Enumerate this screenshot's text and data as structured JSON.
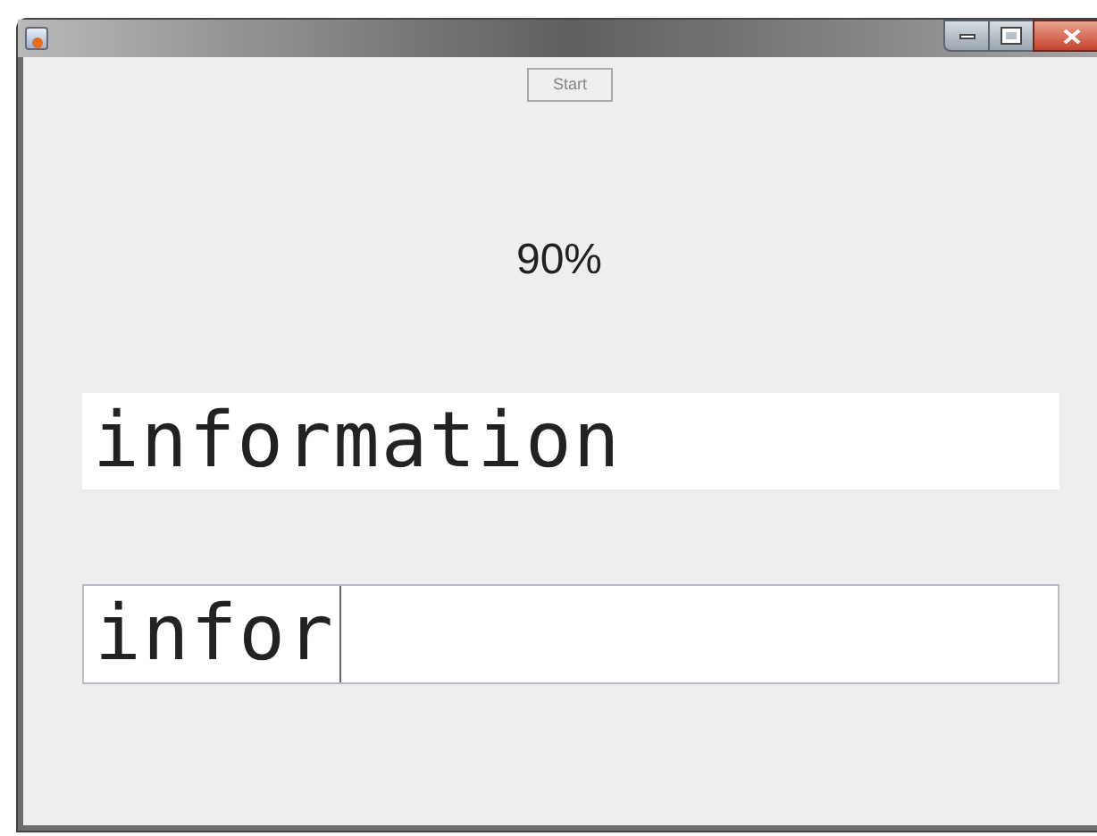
{
  "window": {
    "title_controls": [
      {
        "kind": "minimize"
      },
      {
        "kind": "maximize"
      },
      {
        "kind": "close"
      }
    ]
  },
  "start_button": {
    "label": "Start"
  },
  "progress": {
    "reading": "90%"
  },
  "target_word": {
    "text": "information"
  },
  "typing_field": {
    "value": "infor"
  }
}
